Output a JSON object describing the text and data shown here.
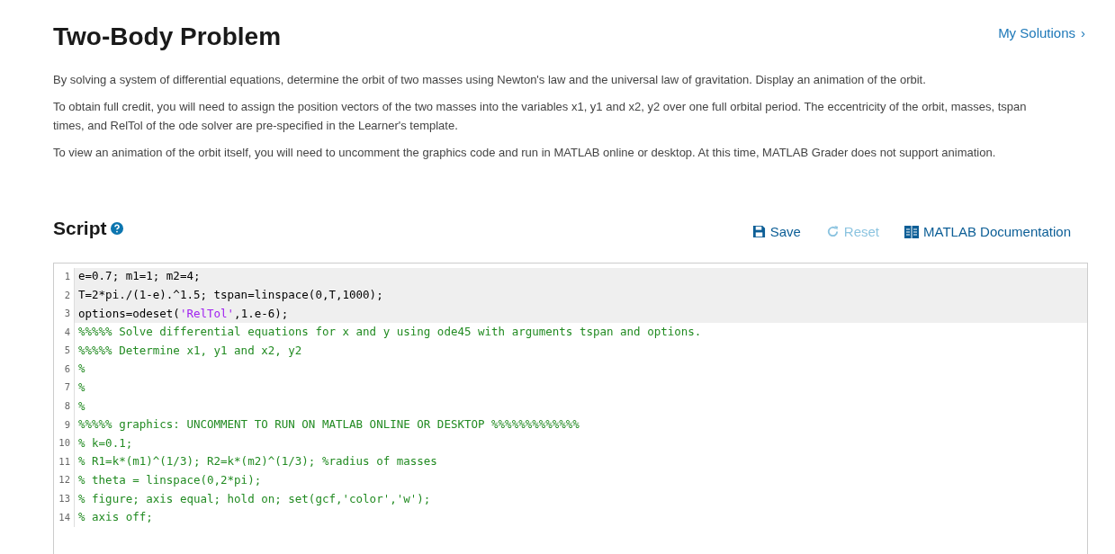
{
  "title": "Two-Body Problem",
  "my_solutions_link": {
    "label": "My Solutions",
    "chevron": "›"
  },
  "description": [
    "By solving a system of differential equations, determine the orbit of two masses using Newton's law and the universal law of gravitation.  Display an animation of the orbit.",
    "To obtain full credit, you will need to assign the position vectors of the two masses into the variables x1, y1 and x2, y2 over one full orbital period.  The eccentricity of the orbit, masses, tspan times, and RelTol of the ode solver are pre-specified in the Learner's template.",
    "To view an animation of the orbit itself, you will need to uncomment the graphics code and run  in MATLAB online or desktop.  At this time, MATLAB Grader does not support animation."
  ],
  "script_section": {
    "heading": "Script",
    "toolbar": [
      {
        "kind": "save",
        "label": "Save",
        "disabled": false
      },
      {
        "kind": "reset",
        "label": "Reset",
        "disabled": true
      },
      {
        "kind": "docs",
        "label": "MATLAB Documentation",
        "disabled": false
      }
    ]
  },
  "editor": {
    "lines": [
      {
        "number": "1",
        "locked": true,
        "tokens": [
          {
            "kind": "code",
            "text": "e=0.7; m1=1; m2=4;"
          }
        ]
      },
      {
        "number": "2",
        "locked": true,
        "tokens": [
          {
            "kind": "code",
            "text": "T=2*pi./(1-e).^1.5; tspan=linspace(0,T,1000);"
          }
        ]
      },
      {
        "number": "3",
        "locked": true,
        "tokens": [
          {
            "kind": "code",
            "text": "options=odeset("
          },
          {
            "kind": "string",
            "text": "'RelTol'"
          },
          {
            "kind": "code",
            "text": ",1.e-6);"
          }
        ]
      },
      {
        "number": "4",
        "locked": false,
        "tokens": [
          {
            "kind": "comment",
            "text": "%%%%% Solve differential equations for x and y using ode45 with arguments tspan and options."
          }
        ]
      },
      {
        "number": "5",
        "locked": false,
        "tokens": [
          {
            "kind": "comment",
            "text": "%%%%% Determine x1, y1 and x2, y2"
          }
        ]
      },
      {
        "number": "6",
        "locked": false,
        "tokens": [
          {
            "kind": "comment",
            "text": "%"
          }
        ]
      },
      {
        "number": "7",
        "locked": false,
        "tokens": [
          {
            "kind": "comment",
            "text": "%"
          }
        ]
      },
      {
        "number": "8",
        "locked": false,
        "tokens": [
          {
            "kind": "comment",
            "text": "%"
          }
        ]
      },
      {
        "number": "9",
        "locked": false,
        "tokens": [
          {
            "kind": "comment",
            "text": "%%%%% graphics: UNCOMMENT TO RUN ON MATLAB ONLINE OR DESKTOP %%%%%%%%%%%%%"
          }
        ]
      },
      {
        "number": "10",
        "locked": false,
        "tokens": [
          {
            "kind": "comment",
            "text": "% k=0.1;"
          }
        ]
      },
      {
        "number": "11",
        "locked": false,
        "tokens": [
          {
            "kind": "comment",
            "text": "% R1=k*(m1)^(1/3); R2=k*(m2)^(1/3); %radius of masses"
          }
        ]
      },
      {
        "number": "12",
        "locked": false,
        "tokens": [
          {
            "kind": "comment",
            "text": "% theta = linspace(0,2*pi);"
          }
        ]
      },
      {
        "number": "13",
        "locked": false,
        "tokens": [
          {
            "kind": "comment",
            "text": "% figure; axis equal; hold on; set(gcf,'color','w');"
          }
        ]
      },
      {
        "number": "14",
        "locked": false,
        "tokens": [
          {
            "kind": "comment",
            "text": "% axis off;"
          }
        ]
      }
    ]
  }
}
